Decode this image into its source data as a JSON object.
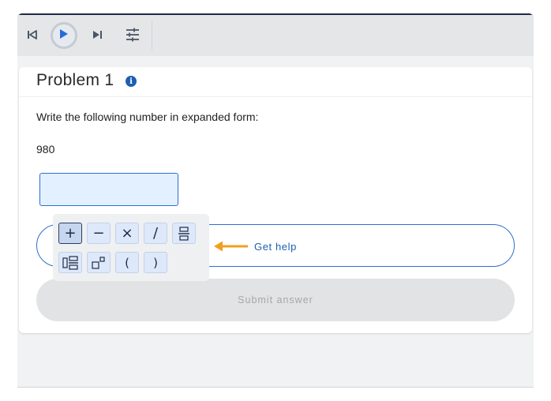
{
  "problem": {
    "title": "Problem 1",
    "info_icon": "i",
    "prompt": "Write the following number in expanded form:",
    "number": "980"
  },
  "answer_field": {
    "value": ""
  },
  "keypad": {
    "row1": [
      "+",
      "−",
      "×",
      "/",
      "fraction"
    ],
    "row2": [
      "mixed-number",
      "exponent",
      "(",
      ")"
    ]
  },
  "help": {
    "label": "Get help",
    "arrow_color": "#f0a020"
  },
  "submit": {
    "label": "Submit answer"
  },
  "toolbar": {
    "icons": [
      "skip-back-icon",
      "play-icon",
      "skip-forward-icon",
      "settings-sliders-icon"
    ]
  },
  "colors": {
    "accent": "#2e6fd0",
    "info": "#1d5fb0",
    "header_border": "#1f2a44"
  }
}
